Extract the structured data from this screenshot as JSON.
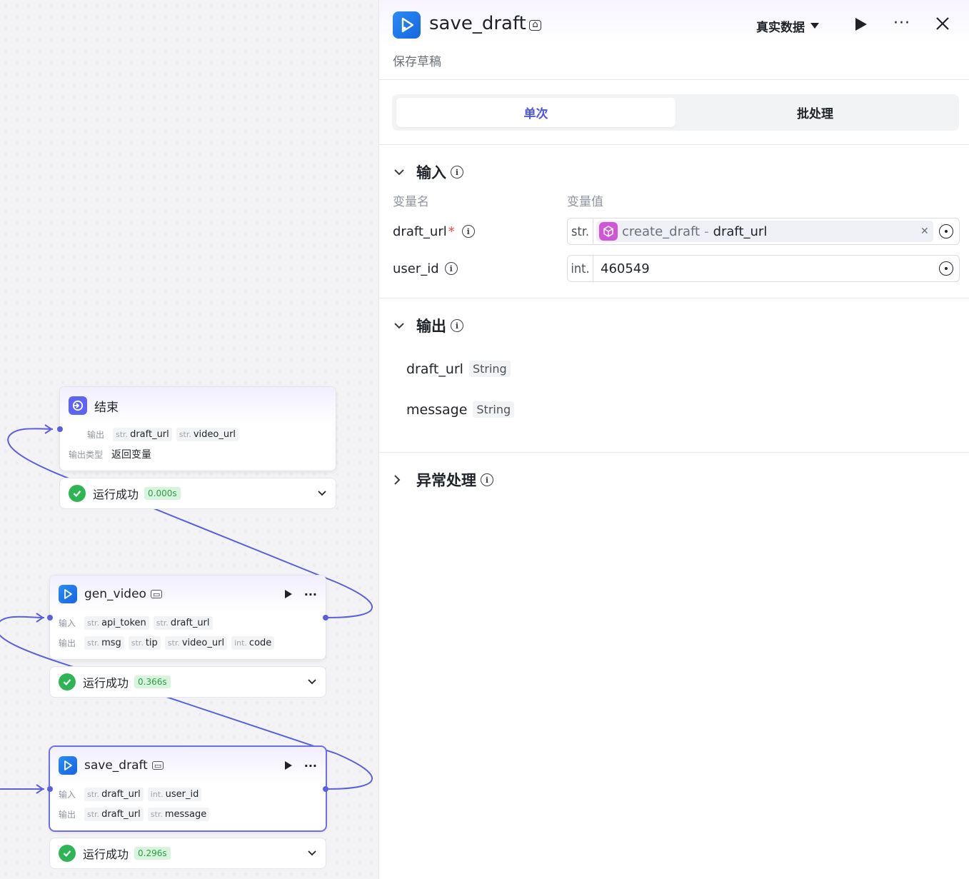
{
  "canvas": {
    "end_node": {
      "title": "结束",
      "output_label": "输出",
      "outputs": [
        {
          "type": "str.",
          "name": "draft_url"
        },
        {
          "type": "str.",
          "name": "video_url"
        }
      ],
      "output_type_label": "输出类型",
      "output_type_value": "返回变量",
      "status": "运行成功",
      "time": "0.000s"
    },
    "gen_video_node": {
      "title": "gen_video",
      "input_label": "输入",
      "output_label": "输出",
      "inputs": [
        {
          "type": "str.",
          "name": "api_token"
        },
        {
          "type": "str.",
          "name": "draft_url"
        }
      ],
      "outputs": [
        {
          "type": "str.",
          "name": "msg"
        },
        {
          "type": "str.",
          "name": "tip"
        },
        {
          "type": "str.",
          "name": "video_url"
        },
        {
          "type": "int.",
          "name": "code"
        }
      ],
      "status": "运行成功",
      "time": "0.366s"
    },
    "save_draft_node": {
      "title": "save_draft",
      "input_label": "输入",
      "output_label": "输出",
      "inputs": [
        {
          "type": "str.",
          "name": "draft_url"
        },
        {
          "type": "int.",
          "name": "user_id"
        }
      ],
      "outputs": [
        {
          "type": "str.",
          "name": "draft_url"
        },
        {
          "type": "str.",
          "name": "message"
        }
      ],
      "status": "运行成功",
      "time": "0.296s"
    }
  },
  "panel": {
    "title": "save_draft",
    "subtitle": "保存草稿",
    "data_mode": "真实数据",
    "tabs": [
      {
        "label": "单次",
        "active": true
      },
      {
        "label": "批处理",
        "active": false
      }
    ],
    "input_section": {
      "title": "输入",
      "col_name": "变量名",
      "col_value": "变量值",
      "rows": [
        {
          "name": "draft_url",
          "required": "*",
          "type": "str.",
          "ref_source": "create_draft",
          "ref_sep": "-",
          "ref_var": "draft_url"
        },
        {
          "name": "user_id",
          "type": "int.",
          "value": "460549"
        }
      ]
    },
    "output_section": {
      "title": "输出",
      "rows": [
        {
          "name": "draft_url",
          "type": "String"
        },
        {
          "name": "message",
          "type": "String"
        }
      ]
    },
    "error_section": {
      "title": "异常处理"
    }
  },
  "colors": {
    "accent": "#4c56e6",
    "edge": "#5a5fe0",
    "success": "#2fb455",
    "plugin_icon": "#1765e0"
  }
}
